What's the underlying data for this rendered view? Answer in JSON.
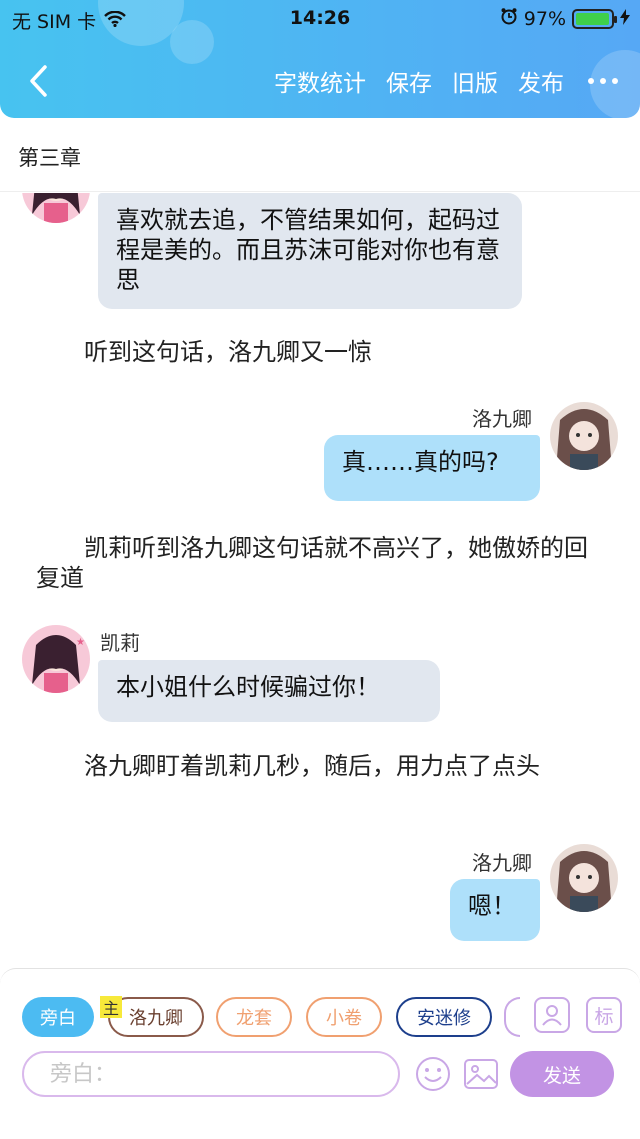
{
  "status_bar": {
    "carrier": "无 SIM 卡",
    "time": "14:26",
    "battery_text": "97%",
    "battery_level": 0.97
  },
  "nav": {
    "back_icon": "chevron-left-icon",
    "actions": [
      "字数统计",
      "保存",
      "旧版",
      "发布"
    ],
    "more_icon": "more-dots-icon"
  },
  "chapter_title": "第三章",
  "messages": [
    {
      "type": "left",
      "speaker": "",
      "text": "喜欢就去追，不管结果如何，起码过程是美的。而且苏沫可能对你也有意思"
    },
    {
      "type": "narration",
      "text": "听到这句话，洛九卿又一惊"
    },
    {
      "type": "right",
      "speaker": "洛九卿",
      "text": "真……真的吗?"
    },
    {
      "type": "narration",
      "text": "凯莉听到洛九卿这句话就不高兴了，她傲娇的回复道"
    },
    {
      "type": "left",
      "speaker": "凯莉",
      "text": "本小姐什么时候骗过你！"
    },
    {
      "type": "narration",
      "text": "洛九卿盯着凯莉几秒，随后，用力点了点头"
    },
    {
      "type": "right",
      "speaker": "洛九卿",
      "text": "嗯！"
    }
  ],
  "roles": {
    "narrator": "旁白",
    "main_tag": "主",
    "chars": [
      {
        "name": "洛九卿",
        "color": "#8a5a4a"
      },
      {
        "name": "龙套",
        "color": "#f0a070"
      },
      {
        "name": "小卷",
        "color": "#f0a070"
      },
      {
        "name": "安迷修",
        "color": "#1d3f8c"
      }
    ],
    "tag_label": "标"
  },
  "input": {
    "placeholder": "旁白：",
    "send_label": "发送"
  },
  "colors": {
    "header": "#4fb4f3",
    "bubble_left": "#e1e7ef",
    "bubble_right": "#aee0fa",
    "send": "#c293e4"
  }
}
